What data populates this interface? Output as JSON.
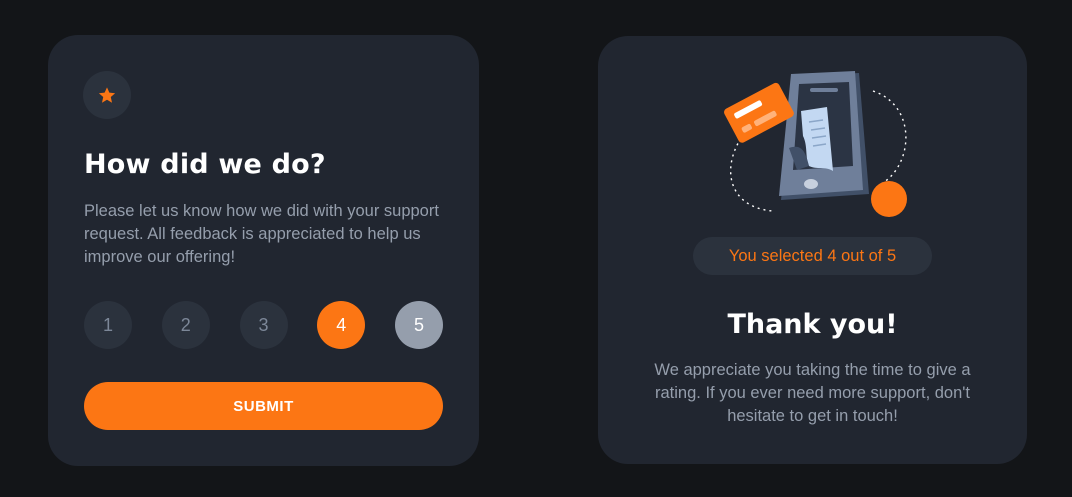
{
  "colors": {
    "background": "#131518",
    "card": "#212630",
    "accent": "#fc7614",
    "muted_circle": "#2b323d",
    "hover_circle": "#959eac",
    "text_muted": "#959eac",
    "text_white": "#ffffff"
  },
  "rating_card": {
    "icon": "star-icon",
    "title": "How did we do?",
    "description": "Please let us know how we did with your support request. All feedback is appreciated to help us improve our offering!",
    "ratings": [
      {
        "label": "1",
        "state": "default"
      },
      {
        "label": "2",
        "state": "default"
      },
      {
        "label": "3",
        "state": "default"
      },
      {
        "label": "4",
        "state": "selected"
      },
      {
        "label": "5",
        "state": "hovered"
      }
    ],
    "submit_label": "SUBMIT"
  },
  "thankyou_card": {
    "illustration": "phone-receipt-card-illustration",
    "selected_text": "You selected 4 out of 5",
    "title": "Thank you!",
    "description": "We appreciate you taking the time to give a rating. If you ever need more support, don't hesitate to get in touch!"
  }
}
